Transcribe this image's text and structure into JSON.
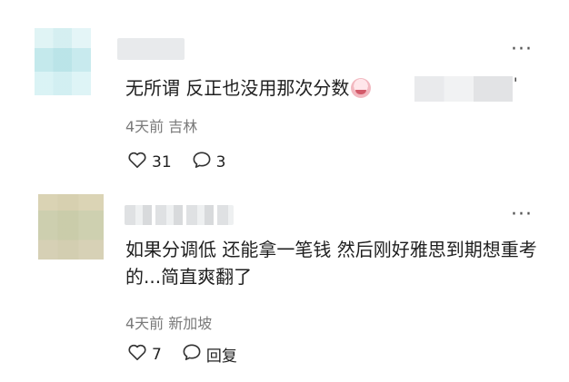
{
  "comments": [
    {
      "text": "无所谓 反正也没用那次分数",
      "trailing": "'",
      "meta": "4天前 吉林",
      "likes": "31",
      "replies": "3",
      "more": "···"
    },
    {
      "text": "如果分调低 还能拿一笔钱 然后刚好雅思到期想重考的...简直爽翻了",
      "meta": "4天前 新加坡",
      "likes": "7",
      "replies": "回复",
      "more": "···"
    }
  ]
}
